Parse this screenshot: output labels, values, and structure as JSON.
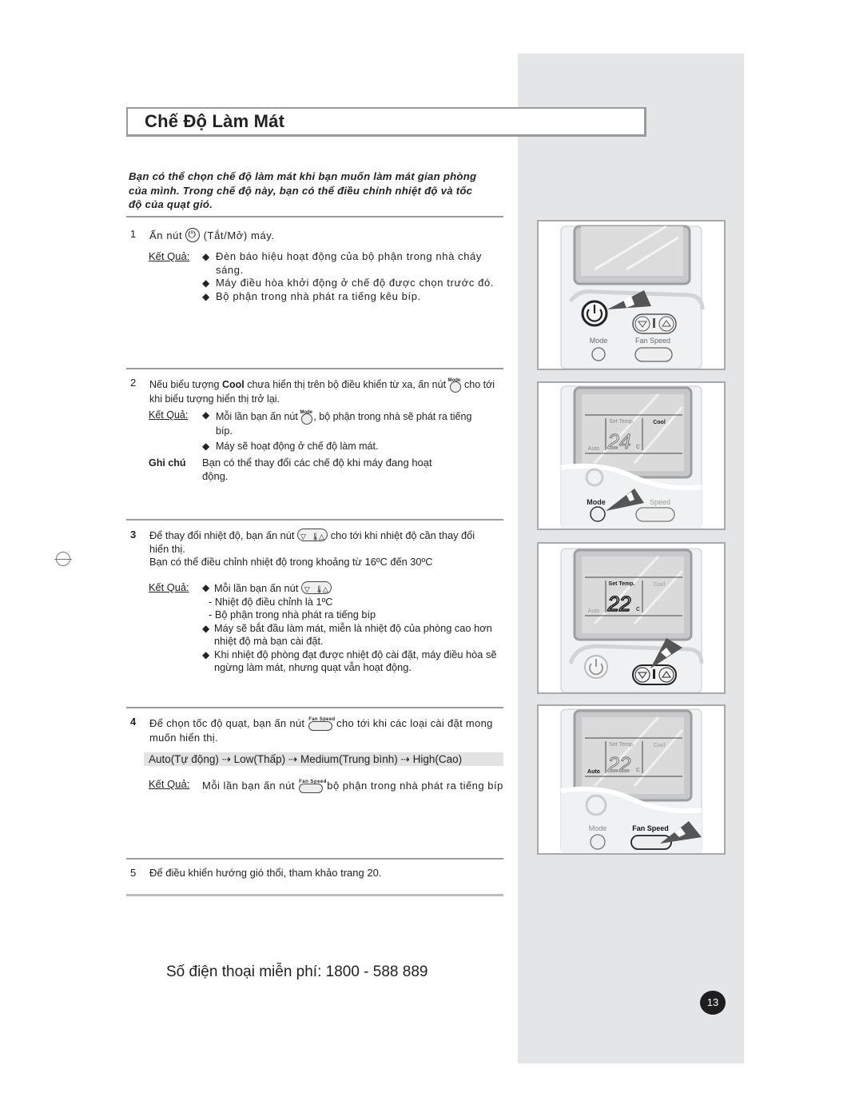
{
  "page": {
    "title": "Chế Độ Làm Mát",
    "intro": "Bạn có thể chọn chế độ làm mát khi bạn muốn làm mát gian phòng của mình. Trong chế độ này, bạn có thể điều chỉnh nhiệt độ và tốc độ của quạt gió.",
    "result_label": "Kết Quả:",
    "note_label": "Ghi chú",
    "page_number": "13",
    "phone": "Số điện thoại miễn phí: 1800 - 588 889"
  },
  "icons": {
    "power": "power-button-icon",
    "mode": "mode-button-icon",
    "temp": "temperature-buttons-icon",
    "fan": "fan-speed-button-icon",
    "mode_label": "Mode",
    "fan_label": "Fan Speed"
  },
  "steps": [
    {
      "number": "1",
      "text_before": "Ấn nút",
      "text_after": "(Tắt/Mở) máy.",
      "results": [
        "Đèn báo hiệu hoạt động của bộ phận trong nhà cháy sáng.",
        "Máy điều hòa khởi động ở chế độ được chọn trước đó.",
        "Bộ phận trong nhà phát ra tiếng kêu bíp."
      ]
    },
    {
      "number": "2",
      "text_a": "Nếu biểu tượng",
      "text_bold": "Cool",
      "text_b": "chưa hiển thị trên bộ điều khiển từ xa, ấn nút",
      "text_c": "cho tới khi biểu tượng hiển thị trở lại.",
      "result_1a": "Mỗi lần bạn ấn nút",
      "result_1b": ", bộ phận trong nhà sẽ phát ra tiếng bíp.",
      "result_2": "Máy sẽ hoạt động ở chế độ làm mát.",
      "note": "Bạn có thể thay đổi các chế độ khi máy đang hoạt động."
    },
    {
      "number": "3",
      "text_a": "Để thay đổi nhiệt độ, bạn ấn nút",
      "text_b": "cho tới khi nhiệt độ cần thay đổi hiển thị.",
      "range": "Bạn có thể điều chỉnh nhiệt độ trong khoảng từ 16ºC đến 30ºC",
      "result_1": "Mỗi lần bạn ấn nút",
      "sub_1": "- Nhiệt độ điều chỉnh là 1ºC",
      "sub_2": "- Bộ phận trong nhà phát ra tiếng bíp",
      "result_2": "Máy sẽ bắt đầu làm mát, miễn là nhiệt độ của phòng cao hơn nhiệt độ mà bạn cài đặt.",
      "result_3": "Khi nhiệt độ phòng đạt được nhiệt độ cài đặt, máy điều hòa sẽ ngừng làm mát, nhưng quạt vẫn hoạt động."
    },
    {
      "number": "4",
      "text_a": "Để chọn tốc độ quạt, bạn ấn nút",
      "text_b": "cho tới khi các loại cài đặt mong muốn hiển thị.",
      "sequence": "Auto(Tự động) ⇢ Low(Thấp) ⇢ Medium(Trung bình) ⇢ High(Cao)",
      "result_a": "Mỗi lần bạn ấn nút",
      "result_b": "bộ phận trong nhà phát ra tiếng bíp"
    },
    {
      "number": "5",
      "text": "Để điều khiển hướng gió thổi, tham khảo trang 20."
    }
  ],
  "figures": [
    {
      "name": "remote-power",
      "highlight": "power",
      "display": "blank"
    },
    {
      "name": "remote-mode",
      "highlight": "mode",
      "set_temp": "Set Temp.",
      "temp": "24",
      "unit": "c",
      "mode": "Cool",
      "fan": "Auto",
      "bold": "mode"
    },
    {
      "name": "remote-temp",
      "highlight": "temp",
      "set_temp": "Set Temp.",
      "temp": "22",
      "unit": "c",
      "mode": "Cool",
      "fan": "Auto",
      "bold": "set_temp"
    },
    {
      "name": "remote-fan",
      "highlight": "fan",
      "set_temp": "Set Temp.",
      "temp": "22",
      "unit": "c",
      "mode": "Cool",
      "fan": "Auto",
      "bold": "fan"
    }
  ],
  "remote_labels": {
    "mode": "Mode",
    "fan_speed": "Fan Speed",
    "speed_partial": "Speed"
  }
}
